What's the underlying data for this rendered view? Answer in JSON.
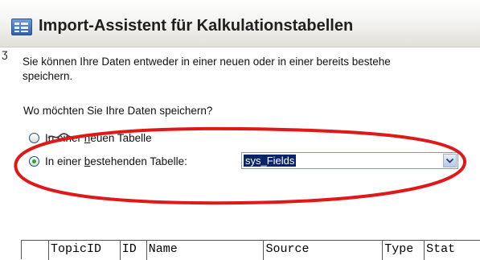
{
  "window": {
    "title": "Import-Assistent für Kalkulationstabellen",
    "icon": "spreadsheet-icon"
  },
  "content": {
    "side_mark": "ʒ",
    "intro_line1": "Sie können Ihre Daten entweder in einer neuen oder in einer bereits bestehe",
    "intro_line2": "speichern.",
    "question": "Wo möchten Sie Ihre Daten speichern?",
    "option_new": {
      "prefix": "In ",
      "middle": "einer ",
      "accel": "n",
      "suffix": "euen Tabelle",
      "selected": false
    },
    "option_existing": {
      "prefix": "In einer ",
      "accel": "b",
      "suffix": "estehenden Tabelle:",
      "selected": true
    },
    "table_select": {
      "value": "sys_Fields",
      "icon": "chevron-down-icon"
    }
  },
  "grid": {
    "headers": [
      "",
      "TopicID",
      "ID",
      "Name",
      "Source",
      "Type",
      "Stat"
    ]
  },
  "colors": {
    "annotation_ellipse": "#e01818",
    "selection": "#0a246a",
    "radio_dot": "#2ea32e"
  }
}
